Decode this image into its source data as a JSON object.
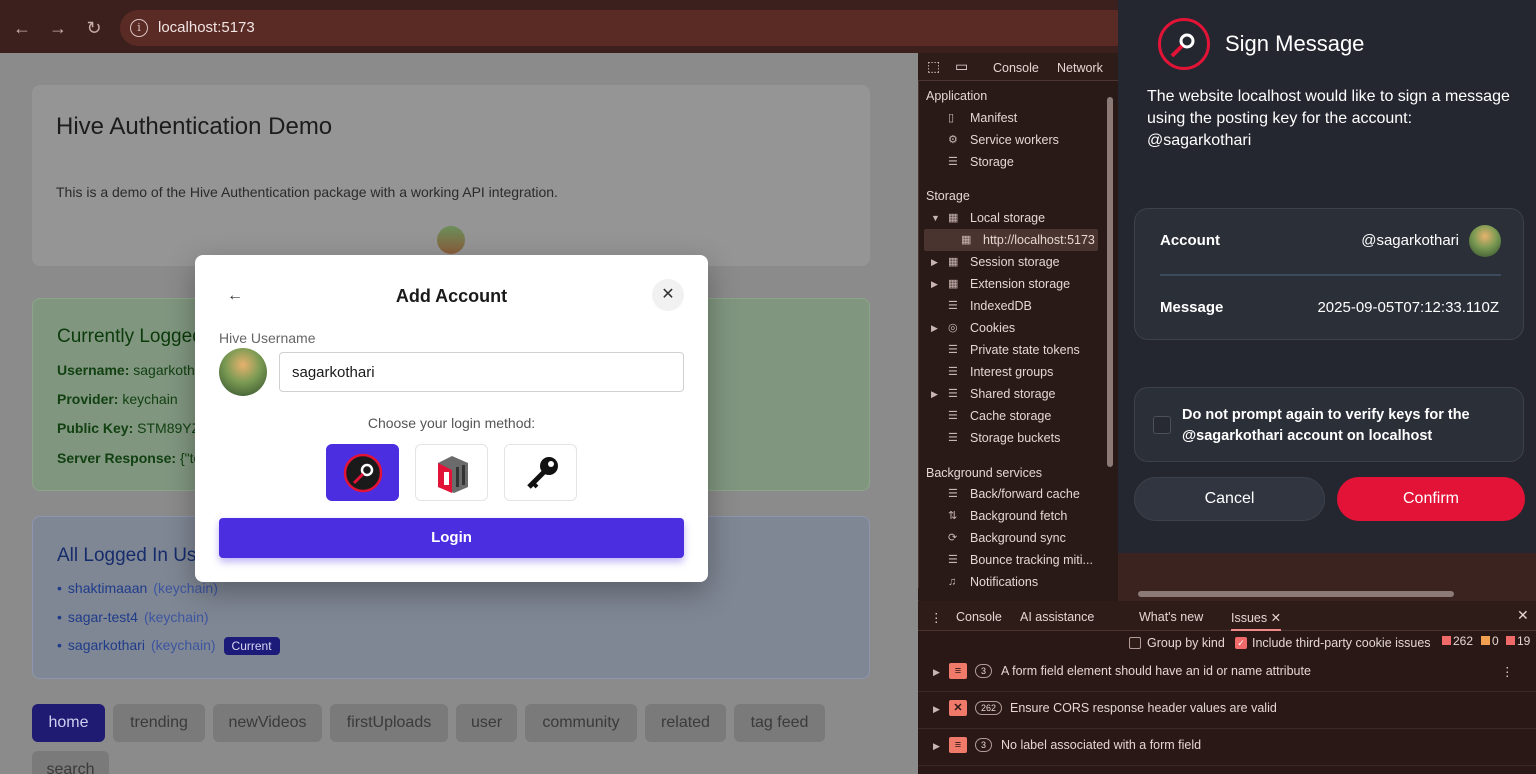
{
  "browser": {
    "url": "localhost:5173"
  },
  "page": {
    "header": {
      "title": "Hive Authentication Demo",
      "description": "This is a demo of the Hive Authentication package with a working API integration.",
      "avatar_name": "sagarkothari"
    },
    "current": {
      "title": "Currently Logged",
      "username_label": "Username:",
      "username_value": "sagarkoth",
      "provider_label": "Provider:",
      "provider_value": "keychain",
      "pubkey_label": "Public Key:",
      "pubkey_value": "STM89YZ",
      "response_label": "Server Response:",
      "response_value": "{\"to"
    },
    "all_users": {
      "title": "All Logged In Use",
      "users": [
        {
          "name": "shaktimaaan",
          "provider": "(keychain)"
        },
        {
          "name": "sagar-test4",
          "provider": "(keychain)"
        },
        {
          "name": "sagarkothari",
          "provider": "(keychain)",
          "badge": "Current"
        }
      ]
    },
    "tabs": [
      "home",
      "trending",
      "newVideos",
      "firstUploads",
      "user",
      "community",
      "related",
      "tag feed",
      "search"
    ]
  },
  "modal": {
    "back": "←",
    "title": "Add Account",
    "close": "✕",
    "username_label": "Hive Username",
    "username_value": "sagarkothari",
    "choose_label": "Choose your login method:",
    "login_label": "Login"
  },
  "devtools": {
    "tabs": [
      "Console",
      "Network"
    ],
    "application": {
      "title": "Application",
      "items": [
        "Manifest",
        "Service workers",
        "Storage"
      ]
    },
    "storage": {
      "title": "Storage",
      "items": [
        "Local storage",
        "http://localhost:5173",
        "Session storage",
        "Extension storage",
        "IndexedDB",
        "Cookies",
        "Private state tokens",
        "Interest groups",
        "Shared storage",
        "Cache storage",
        "Storage buckets"
      ]
    },
    "background": {
      "title": "Background services",
      "items": [
        "Back/forward cache",
        "Background fetch",
        "Background sync",
        "Bounce tracking miti...",
        "Notifications"
      ]
    },
    "drawer": {
      "tabs": [
        "Console",
        "AI assistance",
        "What's new",
        "Issues"
      ],
      "group_by_kind": "Group by kind",
      "third_party": "Include third-party cookie issues",
      "counts": {
        "errors": "262",
        "warnings": "0",
        "info": "19"
      },
      "issues": [
        {
          "count": "3",
          "text": "A form field element should have an id or name attribute"
        },
        {
          "count": "262",
          "text": "Ensure CORS response header values are valid"
        },
        {
          "count": "3",
          "text": "No label associated with a form field"
        }
      ]
    }
  },
  "sign": {
    "title": "Sign Message",
    "description": "The website localhost would like to sign a message using the posting key for the account: @sagarkothari",
    "account_label": "Account",
    "account_value": "@sagarkothari",
    "message_label": "Message",
    "message_value": "2025-09-05T07:12:33.110Z",
    "checkbox_text": "Do not prompt again to verify keys for the @sagarkothari account on localhost",
    "cancel": "Cancel",
    "confirm": "Confirm",
    "accent": "#e31337"
  }
}
